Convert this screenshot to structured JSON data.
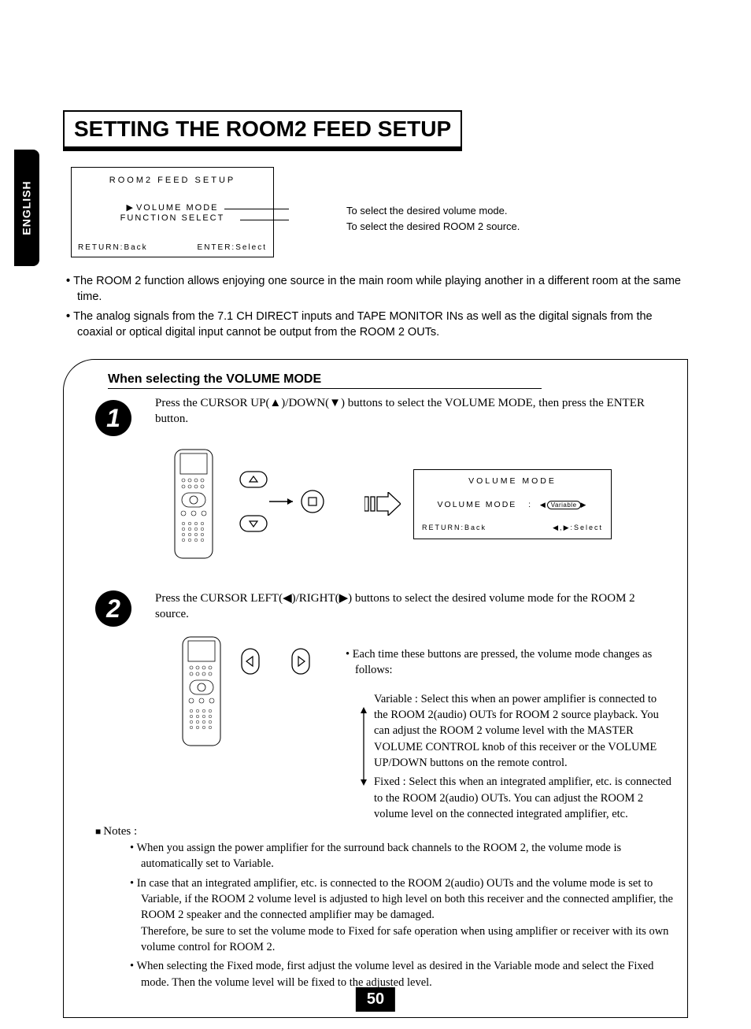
{
  "language_tab": "ENGLISH",
  "title": "SETTING THE ROOM2 FEED SETUP",
  "osd1": {
    "title": "ROOM2 FEED SETUP",
    "line1": "VOLUME MODE",
    "line2": "FUNCTION SELECT",
    "back": "RETURN:Back",
    "enter": "ENTER:Select"
  },
  "callout_line1": "To select the desired volume mode.",
  "callout_line2": "To select the desired ROOM 2 source.",
  "intro_bullets": [
    "The ROOM 2 function allows enjoying one source in the main room while playing another in a different room at the same time.",
    "The analog signals from the 7.1 CH DIRECT inputs and TAPE MONITOR INs as well as the digital signals from the coaxial or optical digital input cannot be output from the ROOM 2 OUTs."
  ],
  "sub_heading": "When selecting the VOLUME MODE",
  "step1": {
    "num": "1",
    "text": "Press the CURSOR UP(▲)/DOWN(▼) buttons to select the VOLUME MODE, then press the ENTER button.",
    "osd": {
      "title": "VOLUME MODE",
      "mid_label": "VOLUME MODE",
      "mid_colon": ":",
      "mid_value": "Variable",
      "back": "RETURN:Back",
      "select": "◀,▶:Select"
    }
  },
  "step2": {
    "num": "2",
    "text": "Press the CURSOR LEFT(◀)/RIGHT(▶) buttons to select the desired volume mode for the ROOM 2 source.",
    "desc_bullet": "Each time these buttons are pressed, the volume mode changes as follows:",
    "variable_label": "Variable :",
    "variable_text": "Select this when an power amplifier is connected to the ROOM 2(audio) OUTs for ROOM 2 source playback. You can adjust the ROOM 2 volume level with the MASTER VOLUME CONTROL knob of this receiver or the VOLUME UP/DOWN buttons on the remote control.",
    "fixed_label": "Fixed :",
    "fixed_text": "Select this when an integrated amplifier, etc. is connected to the ROOM 2(audio) OUTs. You can adjust the ROOM 2 volume level on the connected integrated amplifier, etc."
  },
  "notes_head": "Notes :",
  "notes": [
    "When you assign the power amplifier for the surround back channels to the ROOM 2, the volume mode is automatically set to Variable.",
    "In case that an integrated amplifier, etc. is connected to the ROOM 2(audio) OUTs and the volume mode is set to Variable, if the ROOM 2 volume level is adjusted to high level on both this receiver and the connected amplifier, the ROOM 2 speaker and the connected amplifier may be damaged.\nTherefore, be sure to set the volume mode to Fixed for safe operation when using amplifier or receiver with its own volume control for ROOM 2.",
    "When selecting the Fixed mode, first adjust the volume level as desired in the Variable mode and select the Fixed mode. Then the volume level will be fixed to the adjusted level."
  ],
  "page_number": "50"
}
